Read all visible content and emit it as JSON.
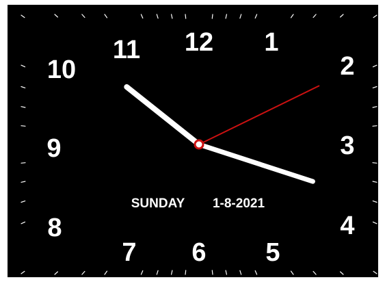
{
  "clock": {
    "numerals": [
      "12",
      "1",
      "2",
      "3",
      "4",
      "5",
      "6",
      "7",
      "8",
      "9",
      "10",
      "11"
    ],
    "day": "SUNDAY",
    "date": "1-8-2021",
    "time": {
      "hour": 10,
      "minute": 17,
      "second": 10
    },
    "colors": {
      "face": "#000000",
      "numerals": "#ffffff",
      "ticks": "#ffffff",
      "hour_hand": "#ffffff",
      "minute_hand": "#ffffff",
      "second_hand": "#cc1111",
      "center_ring": "#cc1111"
    }
  }
}
